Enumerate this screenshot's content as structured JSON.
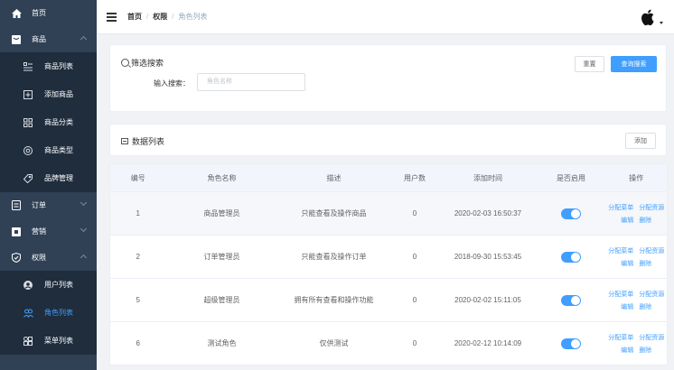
{
  "sidebar": {
    "home": {
      "label": "首页"
    },
    "goods": {
      "label": "商品"
    },
    "goods_items": [
      {
        "label": "商品列表",
        "icon": "list-icon"
      },
      {
        "label": "添加商品",
        "icon": "add-box-icon"
      },
      {
        "label": "商品分类",
        "icon": "grid-icon"
      },
      {
        "label": "商品类型",
        "icon": "circle-icon"
      },
      {
        "label": "品牌管理",
        "icon": "tag-icon"
      }
    ],
    "order": {
      "label": "订单"
    },
    "marketing": {
      "label": "营销"
    },
    "permission": {
      "label": "权限"
    },
    "permission_items": [
      {
        "label": "用户列表",
        "icon": "user-icon"
      },
      {
        "label": "角色列表",
        "icon": "roles-icon"
      },
      {
        "label": "菜单列表",
        "icon": "menu-grid-icon"
      }
    ]
  },
  "header": {
    "breadcrumb": [
      "首页",
      "权限",
      "角色列表"
    ],
    "separator": "/"
  },
  "search": {
    "title": "筛选搜索",
    "label": "输入搜索：",
    "placeholder": "角色名称",
    "reset_label": "重置",
    "query_label": "查询搜索"
  },
  "list": {
    "title": "数据列表",
    "add_label": "添加"
  },
  "table": {
    "columns": [
      "编号",
      "角色名称",
      "描述",
      "用户数",
      "添加时间",
      "是否启用",
      "操作"
    ],
    "rows": [
      {
        "id": "1",
        "name": "商品管理员",
        "desc": "只能查看及操作商品",
        "users": "0",
        "time": "2020-02-03 16:50:37",
        "enabled": true
      },
      {
        "id": "2",
        "name": "订单管理员",
        "desc": "只能查看及操作订单",
        "users": "0",
        "time": "2018-09-30 15:53:45",
        "enabled": true
      },
      {
        "id": "5",
        "name": "超级管理员",
        "desc": "拥有所有查看和操作功能",
        "users": "0",
        "time": "2020-02-02 15:11:05",
        "enabled": true
      },
      {
        "id": "6",
        "name": "测试角色",
        "desc": "仅供测试",
        "users": "0",
        "time": "2020-02-12 10:14:09",
        "enabled": true
      }
    ],
    "ops": {
      "assign_menu": "分配菜单",
      "assign_resource": "分配资源",
      "edit": "编辑",
      "delete": "删除"
    }
  },
  "colors": {
    "sidebar_bg": "#304156",
    "submenu_bg": "#1f2d3d",
    "accent": "#409eff"
  }
}
